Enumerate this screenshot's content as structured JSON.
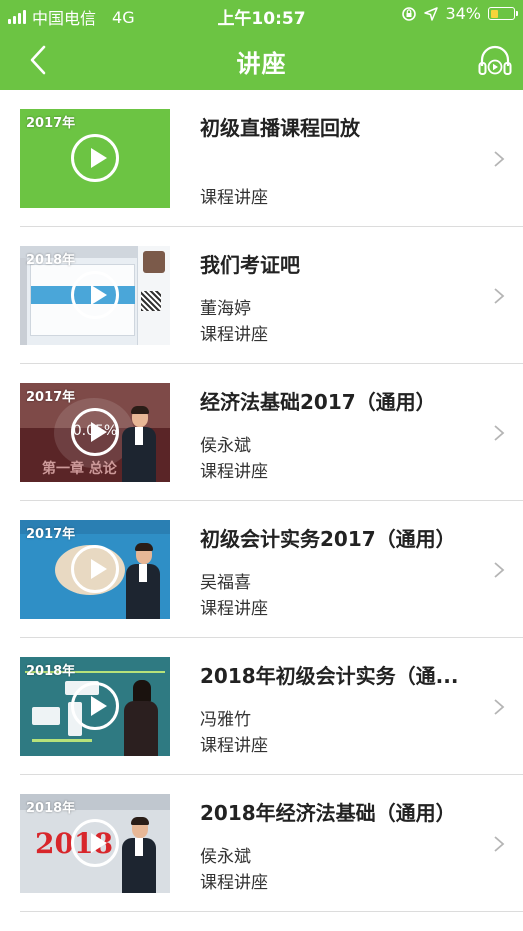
{
  "status_bar": {
    "carrier": "中国电信",
    "network": "4G",
    "time": "上午10:57",
    "battery_percent": "34%",
    "battery_level": 0.34,
    "signal_bars": 4,
    "icons": [
      "signal-icon",
      "orientation-lock-icon",
      "location-icon",
      "battery-icon"
    ]
  },
  "nav": {
    "title": "讲座",
    "back_icon": "chevron-left-icon",
    "audio_icon": "headphones-play-icon"
  },
  "colors": {
    "primary_green": "#6cc443",
    "battery_fill": "#f7d43a"
  },
  "lectures": [
    {
      "title": "初级直播课程回放",
      "teacher": "",
      "category": "课程讲座",
      "year_badge": "2017年",
      "progress": ""
    },
    {
      "title": "我们考证吧",
      "teacher": "董海婷",
      "category": "课程讲座",
      "year_badge": "2018年",
      "progress": ""
    },
    {
      "title": "经济法基础2017（通用）",
      "teacher": "侯永斌",
      "category": "课程讲座",
      "year_badge": "2017年",
      "progress": "0.05%"
    },
    {
      "title": "初级会计实务2017（通用）",
      "teacher": "吴福喜",
      "category": "课程讲座",
      "year_badge": "2017年",
      "progress": ""
    },
    {
      "title": "2018年初级会计实务（通...",
      "teacher": "冯雅竹",
      "category": "课程讲座",
      "year_badge": "2018年",
      "progress": ""
    },
    {
      "title": "2018年经济法基础（通用）",
      "teacher": "侯永斌",
      "category": "课程讲座",
      "year_badge": "2018年",
      "progress": ""
    }
  ],
  "thumb_text": {
    "lecture_3": "第一章 总论",
    "lecture_6": "2018"
  }
}
